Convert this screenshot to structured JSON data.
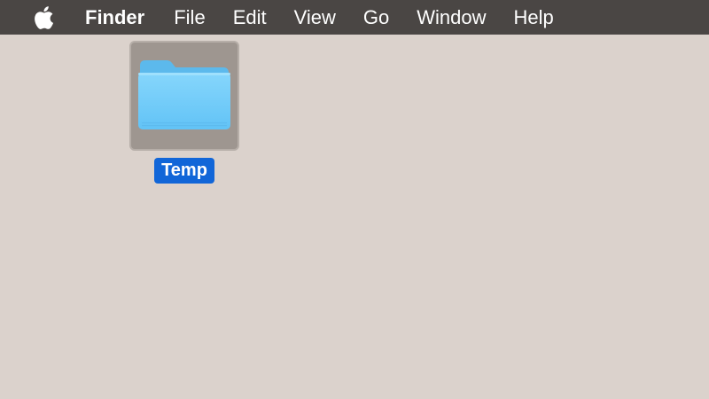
{
  "menubar": {
    "apple_icon": "apple-logo-icon",
    "app_name": "Finder",
    "items": [
      "File",
      "Edit",
      "View",
      "Go",
      "Window",
      "Help"
    ]
  },
  "desktop": {
    "items": [
      {
        "label": "Temp",
        "icon": "folder-icon",
        "selected": true
      }
    ]
  },
  "colors": {
    "menubar_bg": "#4a4644",
    "desktop_bg": "#dbd2cc",
    "selection_label": "#1166d8",
    "folder_blue": "#6ccdf9"
  }
}
